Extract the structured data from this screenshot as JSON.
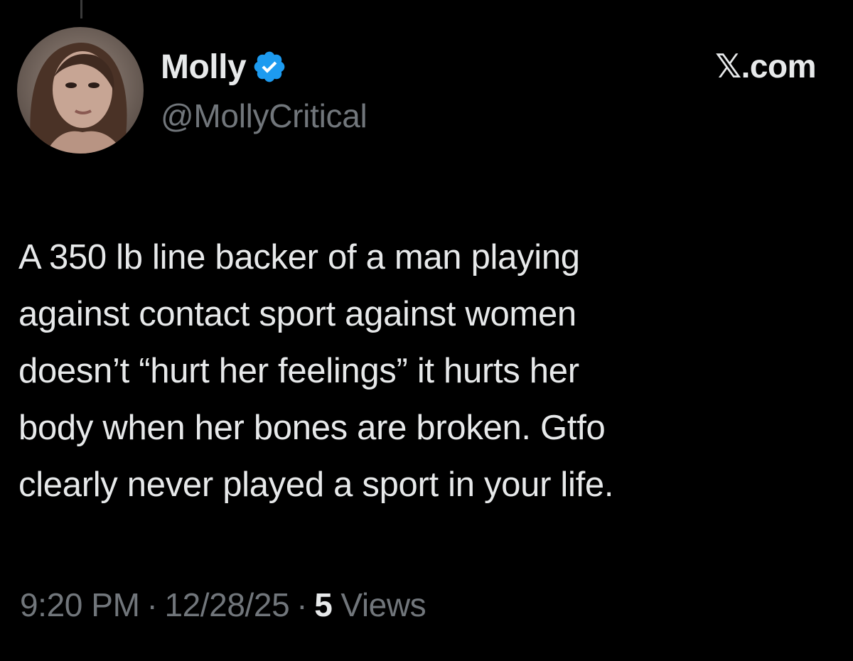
{
  "author": {
    "display_name": "Molly",
    "handle": "@MollyCritical",
    "verified": true,
    "verified_color": "#1d9bf0",
    "avatar": "profile-photo"
  },
  "watermark": "𝕏.com",
  "tweet": {
    "text": "A 350 lb line backer of a man playing\nagainst contact sport against women\ndoesn’t “hurt her feelings” it hurts her\nbody when her bones are broken. Gtfo\nclearly never played a sport in your life."
  },
  "meta": {
    "time": "9:20 PM",
    "separator": "·",
    "date": "12/28/25",
    "views_count": "5",
    "views_label": "Views"
  },
  "colors": {
    "background": "#000000",
    "primary_text": "#e7e9ea",
    "secondary_text": "#71767b"
  }
}
